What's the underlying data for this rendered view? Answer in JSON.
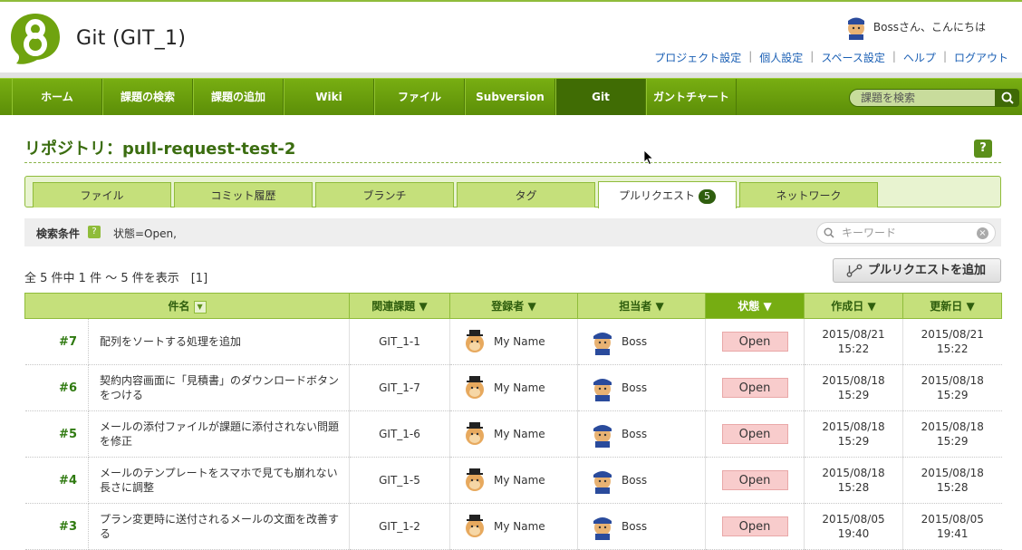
{
  "project": {
    "title": "Git (GIT_1)"
  },
  "user": {
    "greeting": "Bossさん、こんにちは"
  },
  "top_links": [
    "プロジェクト設定",
    "個人設定",
    "スペース設定",
    "ヘルプ",
    "ログアウト"
  ],
  "nav": {
    "items": [
      {
        "label": "ホーム"
      },
      {
        "label": "課題の検索"
      },
      {
        "label": "課題の追加"
      },
      {
        "label": "Wiki"
      },
      {
        "label": "ファイル"
      },
      {
        "label": "Subversion"
      },
      {
        "label": "Git",
        "active": true
      },
      {
        "label": "ガントチャート"
      }
    ],
    "search_placeholder": "課題を検索"
  },
  "repo": {
    "title": "リポジトリ：pull-request-test-2"
  },
  "help_label": "?",
  "tabs": [
    {
      "label": "ファイル"
    },
    {
      "label": "コミット履歴"
    },
    {
      "label": "ブランチ"
    },
    {
      "label": "タグ"
    },
    {
      "label": "プルリクエスト",
      "badge": "5",
      "active": true
    },
    {
      "label": "ネットワーク"
    }
  ],
  "filter": {
    "label": "検索条件",
    "help": "?",
    "condition": "状態=Open,",
    "keyword_placeholder": "キーワード",
    "clear": "×"
  },
  "result_count": "全 5 件中 1 件 〜 5 件を表示　[1]",
  "add_button": "プルリクエストを追加",
  "table": {
    "headers": [
      "件名",
      "関連課題",
      "登録者",
      "担当者",
      "状態",
      "作成日",
      "更新日"
    ],
    "rows": [
      {
        "num": "#7",
        "subject": "配列をソートする処理を追加",
        "issue": "GIT_1-1",
        "author": "My Name",
        "assignee": "Boss",
        "status": "Open",
        "created": [
          "2015/08/21",
          "15:22"
        ],
        "updated": [
          "2015/08/21",
          "15:22"
        ]
      },
      {
        "num": "#6",
        "subject": "契約内容画面に「見積書」のダウンロードボタンをつける",
        "issue": "GIT_1-7",
        "author": "My Name",
        "assignee": "Boss",
        "status": "Open",
        "created": [
          "2015/08/18",
          "15:29"
        ],
        "updated": [
          "2015/08/18",
          "15:29"
        ]
      },
      {
        "num": "#5",
        "subject": "メールの添付ファイルが課題に添付されない問題を修正",
        "issue": "GIT_1-6",
        "author": "My Name",
        "assignee": "Boss",
        "status": "Open",
        "created": [
          "2015/08/18",
          "15:29"
        ],
        "updated": [
          "2015/08/18",
          "15:29"
        ]
      },
      {
        "num": "#4",
        "subject": "メールのテンプレートをスマホで見ても崩れない長さに調整",
        "issue": "GIT_1-5",
        "author": "My Name",
        "assignee": "Boss",
        "status": "Open",
        "created": [
          "2015/08/18",
          "15:28"
        ],
        "updated": [
          "2015/08/18",
          "15:28"
        ]
      },
      {
        "num": "#3",
        "subject": "プラン変更時に送付されるメールの文面を改善する",
        "issue": "GIT_1-2",
        "author": "My Name",
        "assignee": "Boss",
        "status": "Open",
        "created": [
          "2015/08/05",
          "19:40"
        ],
        "updated": [
          "2015/08/05",
          "19:41"
        ]
      }
    ]
  },
  "colors": {
    "brand_green": "#6fa30f",
    "nav_active": "#406c04",
    "status_open_bg": "#f8cccc",
    "link_blue": "#1a5fb4"
  }
}
